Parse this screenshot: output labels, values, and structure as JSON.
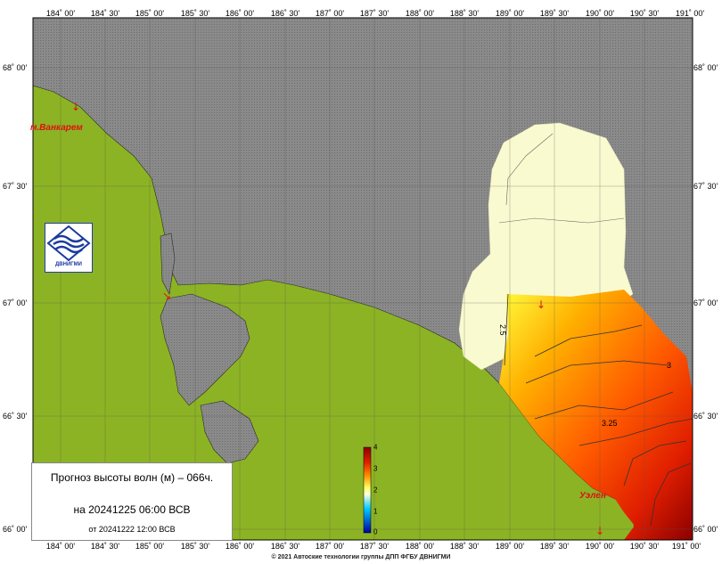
{
  "map": {
    "longitude_labels": [
      "184˚ 00'",
      "184˚ 30'",
      "185˚ 00'",
      "185˚ 30'",
      "186˚ 00'",
      "186˚ 30'",
      "187˚ 00'",
      "187˚ 30'",
      "188˚ 00'",
      "188˚ 30'",
      "189˚ 00'",
      "189˚ 30'",
      "190˚ 00'",
      "190˚ 30'",
      "191˚ 00'"
    ],
    "latitude_labels": [
      "68˚ 00'",
      "67˚ 30'",
      "67˚ 00'",
      "66˚ 30'",
      "66˚ 00'"
    ],
    "places": {
      "vankarem": "м.Ванкарем",
      "uelen": "Уэлен"
    },
    "contour_labels": [
      "2.5",
      "3",
      "3.25"
    ]
  },
  "colorbar": {
    "ticks": [
      "4",
      "3",
      "2",
      "1",
      "0"
    ],
    "colors": [
      "#8b0000",
      "#e02000",
      "#ff8c00",
      "#ffff60",
      "#ffffe0",
      "#00c8ff",
      "#0000a0"
    ]
  },
  "info": {
    "title": "Прогноз высоты волн (м) – 066ч.",
    "valid": "на 20241225 06:00 ВСВ",
    "issued": "от 20241222 12:00 ВСВ"
  },
  "logo": {
    "text": "ДВНИГМИ"
  },
  "footer": "© 2021 Автоские технологии группы ДПП ФГБУ ДВНИГМИ",
  "colors": {
    "land": "#8cb324",
    "ice_or_nodata": "#8a8a8a",
    "wave_low": "#fafad0",
    "wave_high": "#8b0000"
  }
}
